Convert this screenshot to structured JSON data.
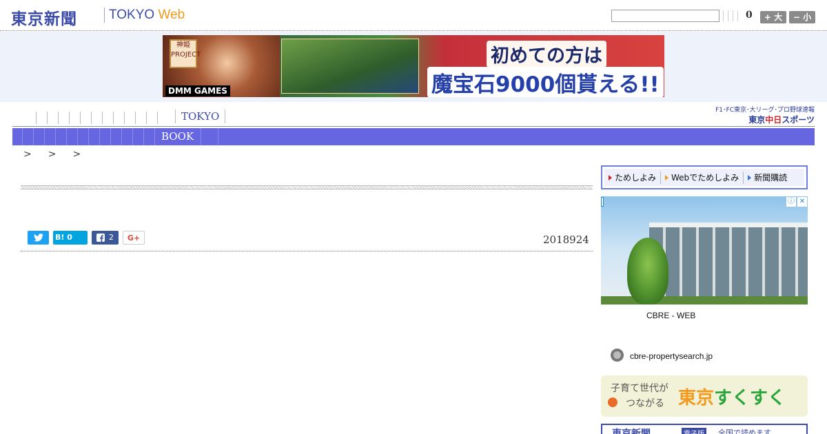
{
  "header": {
    "logo_jp": "東京新聞",
    "logo_en": "TOKYO",
    "logo_en_accent": "Web",
    "search_value": "",
    "counter": "0",
    "font_up_label": "+ 大",
    "font_down_label": "− 小"
  },
  "banner": {
    "brand_badge": "神姫 PROJECT",
    "publisher": "DMM GAMES",
    "headline_top": "初めての方は",
    "headline_bottom": "魔宝石9000個貰える!!"
  },
  "nav_primary": {
    "tab_count": 13,
    "active_label": "TOKYO"
  },
  "chunichi": {
    "subtitle": "F1･FC東京･大リーグ･プロ野球速報",
    "prefix": "東京",
    "name_accent": "中日",
    "name_rest": "スポーツ"
  },
  "nav_secondary": {
    "tab_count": 13,
    "active_label": "BOOK"
  },
  "breadcrumb": {
    "separators": [
      ">",
      ">",
      ">"
    ]
  },
  "article": {
    "date": "2018924",
    "social": {
      "hatena_label": "B!",
      "hatena_count": "0",
      "facebook_count": "2",
      "gplus_label": "G+"
    }
  },
  "sidebar": {
    "services": [
      {
        "label": "ためしよみ",
        "color": "#d0242a"
      },
      {
        "label": "Webでためしよみ",
        "color": "#f19a1d"
      },
      {
        "label": "新聞購読",
        "color": "#3a70d0"
      }
    ],
    "ad": {
      "title": "CBRE - WEB",
      "url": "cbre-propertysearch.jp",
      "choice_info": "ⓘ",
      "choice_close": "✕"
    },
    "sukusuku": {
      "tagline_1": "子育て世代が",
      "tagline_2": "つながる",
      "name_1": "東京",
      "name_2": "すくすく"
    },
    "shimbun": {
      "title": "東京新聞",
      "badge": "電子版",
      "message": "全国で読めます"
    }
  },
  "colors": {
    "brand_blue": "#3b4aa8",
    "brand_orange": "#f19a1d",
    "nav_blue": "#6666e0"
  }
}
